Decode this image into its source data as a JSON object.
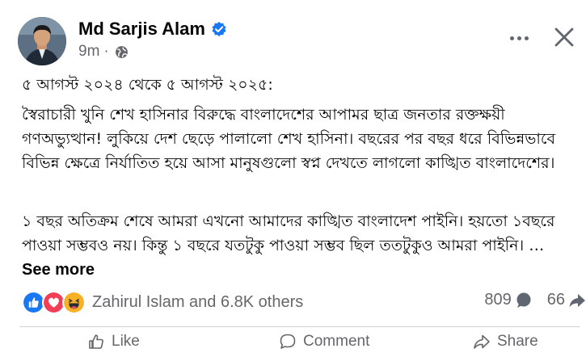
{
  "post": {
    "author": "Md Sarjis Alam",
    "time": "9m",
    "dot": "·",
    "heading": "৫ আগস্ট ২০২৪ থেকে ৫ আগস্ট ২০২৫:",
    "para1": "স্বৈরাচারী খুনি শেখ হাসিনার বিরুদ্ধে বাংলাদেশের আপামর ছাত্র জনতার রক্তক্ষয়ী গণঅভ্যুত্থান! লুকিয়ে দেশ ছেড়ে পালালো শেখ হাসিনা। বছরের পর বছর ধরে বিভিন্নভাবে বিভিন্ন ক্ষেত্রে নির্যাতিত হয়ে আসা মানুষগুলো স্বপ্ন দেখতে লাগলো কাঙ্খিত বাংলাদেশের।",
    "para2": "১ বছর অতিক্রম শেষে আমরা এখনো আমাদের কাঙ্খিত বাংলাদেশ পাইনি। হয়তো ১বছরে পাওয়া সম্ভবও নয়। কিন্তু ১ বছরে যতটুকু পাওয়া সম্ভব ছিল ততটুকুও আমরা পাইনি।",
    "ellipsis": " … ",
    "see_more": "See more"
  },
  "reactions": {
    "names": "Zahirul Islam and 6.8K others",
    "comments": "809",
    "shares": "66",
    "icons": [
      "like-icon",
      "love-icon",
      "haha-icon"
    ]
  },
  "actions": {
    "like": "Like",
    "comment": "Comment",
    "share": "Share"
  },
  "colors": {
    "brand_blue": "#1877f2",
    "love_red": "#f33e58",
    "haha_yellow": "#f7b125",
    "secondary_text": "#65676b"
  }
}
